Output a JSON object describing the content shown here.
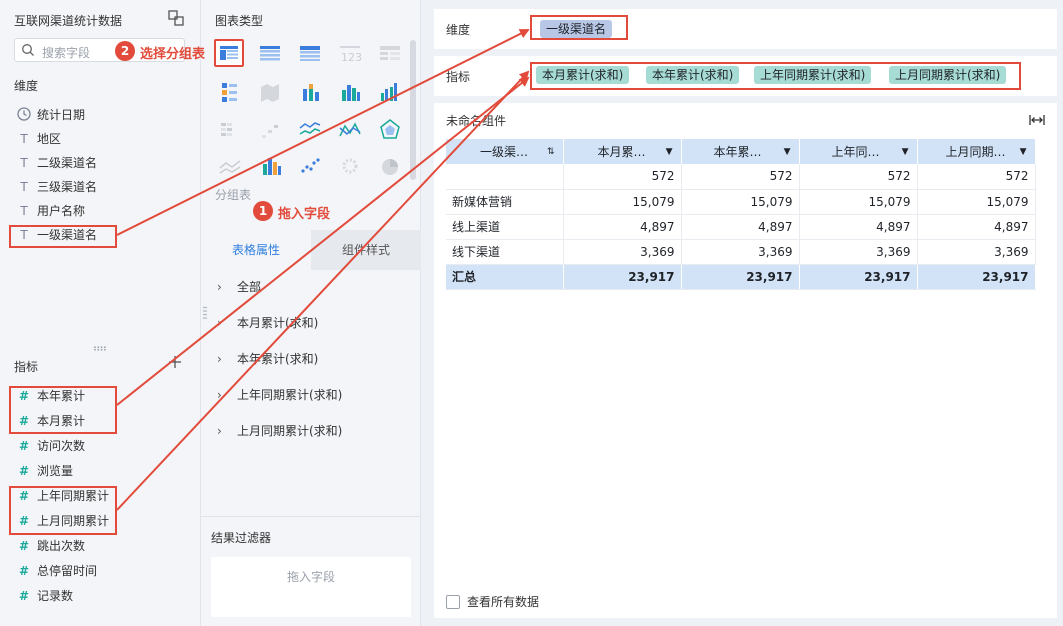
{
  "left": {
    "dataset_title": "互联网渠道统计数据",
    "search_placeholder": "搜索字段",
    "dimension_label": "维度",
    "dimensions": [
      "统计日期",
      "地区",
      "二级渠道名",
      "三级渠道名",
      "用户名称",
      "一级渠道名"
    ],
    "measure_label": "指标",
    "measures": [
      "本年累计",
      "本月累计",
      "访问次数",
      "浏览量",
      "上年同期累计",
      "上月同期累计",
      "跳出次数",
      "总停留时间",
      "记录数"
    ]
  },
  "middle": {
    "chart_type_label": "图表类型",
    "selected_chart_name": "分组表",
    "tab_active": "表格属性",
    "tab_inactive": "组件样式",
    "props": [
      "全部",
      "本月累计(求和)",
      "本年累计(求和)",
      "上年同期累计(求和)",
      "上月同期累计(求和)"
    ],
    "filter_title": "结果过滤器",
    "filter_placeholder": "拖入字段"
  },
  "right": {
    "dimension_label": "维度",
    "dimension_pill": "一级渠道名",
    "measure_label": "指标",
    "measure_pills": [
      "本月累计(求和)",
      "本年累计(求和)",
      "上年同期累计(求和)",
      "上月同期累计(求和)"
    ],
    "widget_title": "未命名组件",
    "table": {
      "headers": [
        "一级渠…",
        "本月累…",
        "本年累…",
        "上年同…",
        "上月同期…"
      ],
      "rows": [
        [
          "",
          "572",
          "572",
          "572",
          "572"
        ],
        [
          "新媒体营销",
          "15,079",
          "15,079",
          "15,079",
          "15,079"
        ],
        [
          "线上渠道",
          "4,897",
          "4,897",
          "4,897",
          "4,897"
        ],
        [
          "线下渠道",
          "3,369",
          "3,369",
          "3,369",
          "3,369"
        ]
      ],
      "total": [
        "汇总",
        "23,917",
        "23,917",
        "23,917",
        "23,917"
      ]
    },
    "view_all_label": "查看所有数据"
  },
  "annotations": {
    "step1_num": "1",
    "step1_text": "拖入字段",
    "step2_num": "2",
    "step2_text": "选择分组表",
    "color": "#e24b3b"
  }
}
